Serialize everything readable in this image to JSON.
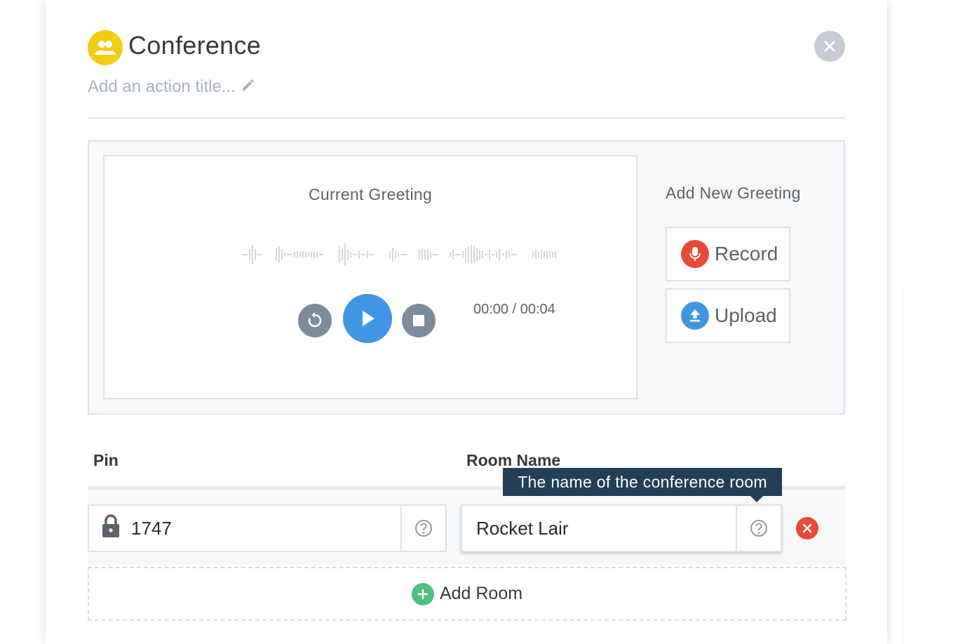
{
  "header": {
    "title": "Conference",
    "subtitle": "Add an action title...",
    "icon": "people-icon",
    "icon_color": "#f2cd14"
  },
  "greeting": {
    "current_label": "Current Greeting",
    "time": "00:00 / 00:04",
    "add_label": "Add New Greeting",
    "record_label": "Record",
    "upload_label": "Upload",
    "play_color": "#3f97e3",
    "record_color": "#e84a37",
    "upload_color": "#3f97e3"
  },
  "rooms": {
    "pin_label": "Pin",
    "room_name_label": "Room Name",
    "pin_value": "1747",
    "room_name_value": "Rocket Lair",
    "tooltip": "The name of the conference room",
    "add_room_label": "Add Room"
  }
}
